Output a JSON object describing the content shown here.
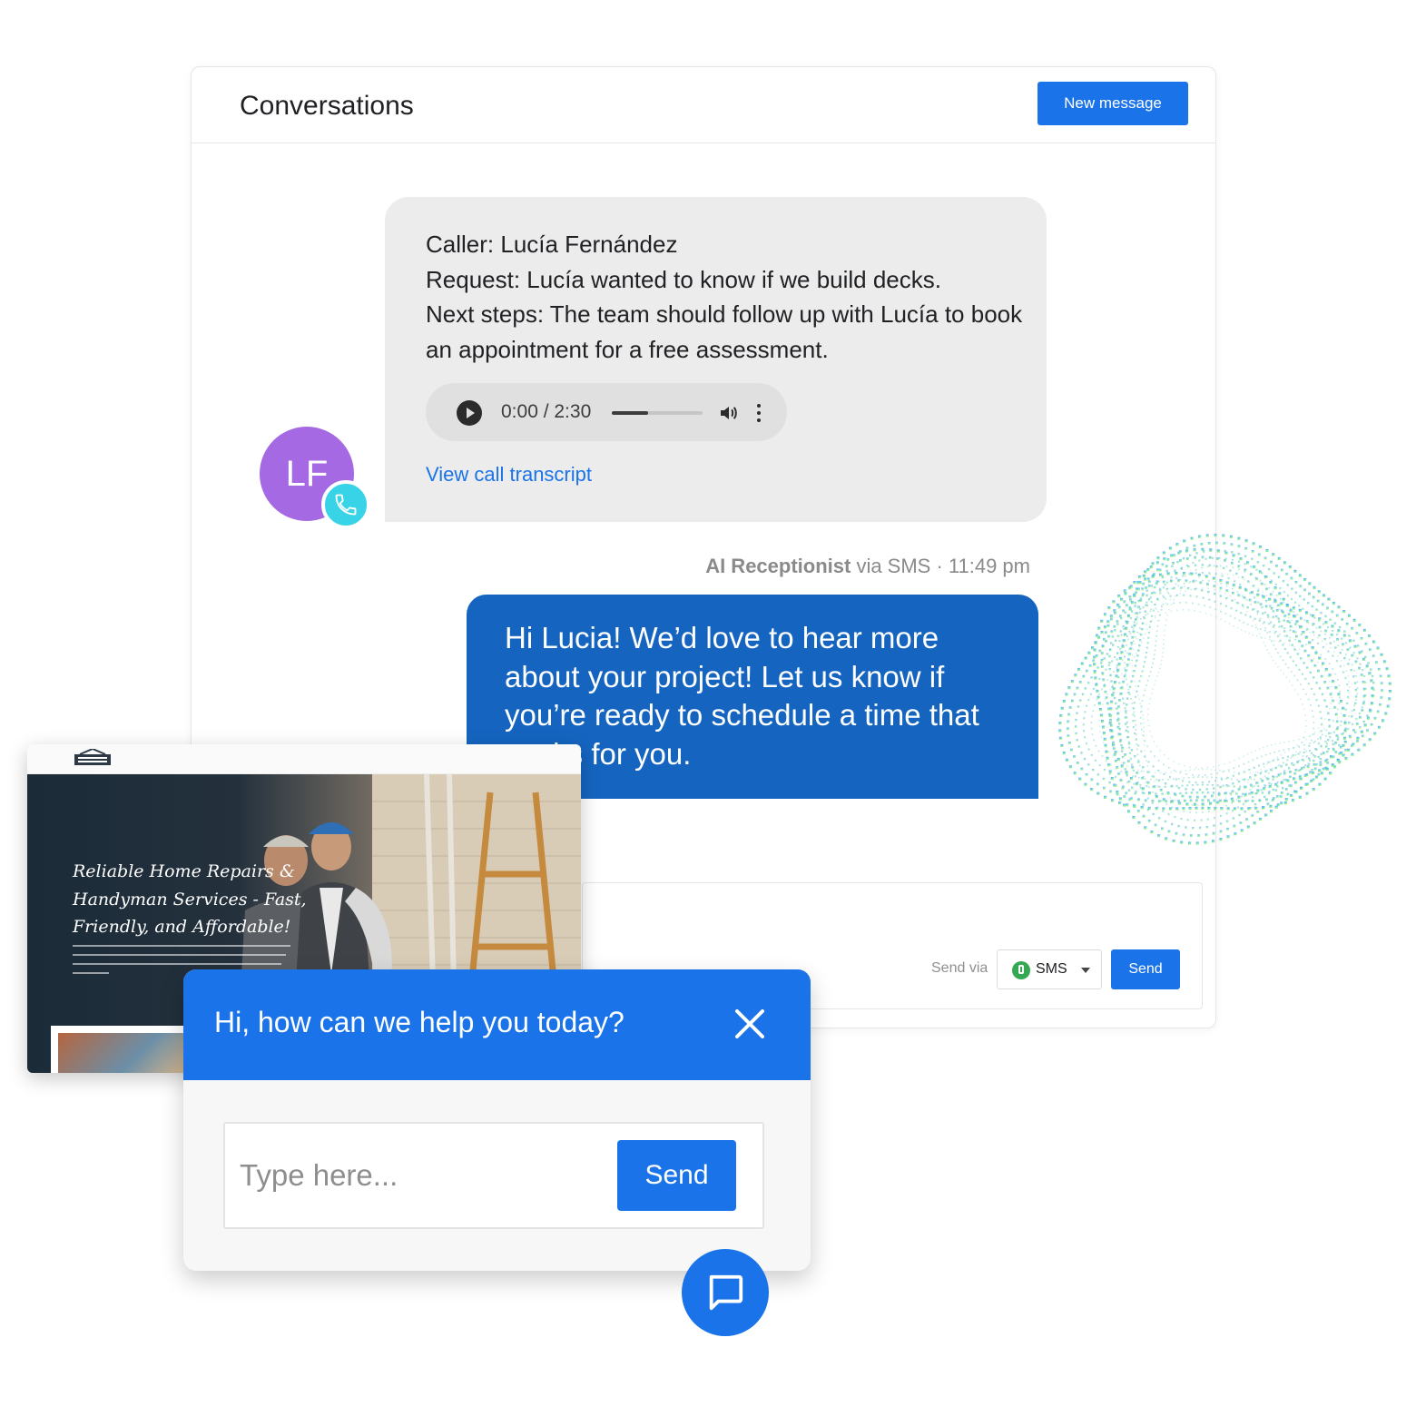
{
  "conversations": {
    "title": "Conversations",
    "new_message_label": "New message",
    "summary": {
      "lines": [
        "Caller: Lucía Fernández",
        "Request: Lucía wanted to know if we build decks.",
        "Next steps: The team should follow up with Lucía to book an appointment for a free assessment."
      ],
      "audio": {
        "time": "0:00 / 2:30",
        "volume_fraction": 0.4,
        "icons": [
          "play-icon",
          "volume-icon",
          "more-vert-icon"
        ]
      },
      "transcript_link": "View call transcript",
      "avatar_initials": "LF",
      "avatar_color": "#a56ae3",
      "avatar_badge_icon": "phone-icon",
      "badge_color": "#38d3e6"
    },
    "meta": {
      "sender": "AI Receptionist",
      "via": " via SMS · 11:49 pm"
    },
    "reply": {
      "text": "Hi Lucia! We’d love to hear more about your project! Let us know if you’re ready to schedule a time that works for you.",
      "color": "#1565c0"
    },
    "compose": {
      "send_via_label": "Send via",
      "channel": "SMS",
      "channel_icon": "sms-icon",
      "send_label": "Send"
    }
  },
  "website": {
    "headline": "Reliable Home Repairs & Handyman Services - Fast, Friendly, and Affordable!"
  },
  "chat_widget": {
    "title": "Hi, how can we help you today?",
    "close_icon": "close-icon",
    "input_placeholder": "Type here...",
    "send_label": "Send",
    "launcher_icon": "chat-bubble-icon",
    "accent": "#1a73e8"
  }
}
